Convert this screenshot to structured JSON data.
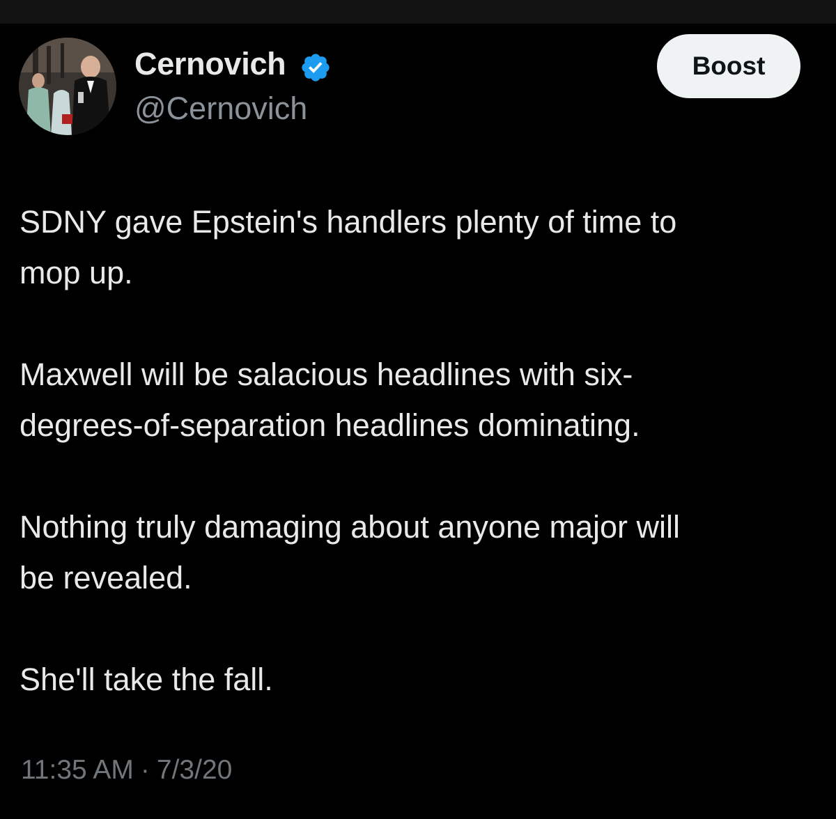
{
  "colors": {
    "background": "#000000",
    "text": "#e7e9ea",
    "secondary_text": "#71767b",
    "verified_blue": "#1d9bf0",
    "button_bg": "#eff3f4"
  },
  "author": {
    "display_name": "Cernovich",
    "handle": "@Cernovich",
    "verified_icon": "verified-badge-icon",
    "avatar": "profile-photo"
  },
  "actions": {
    "boost_label": "Boost"
  },
  "tweet": {
    "paragraphs": [
      "SDNY gave Epstein's handlers plenty of time to\nmop up.",
      "Maxwell will be salacious headlines with six-\ndegrees-of-separation headlines dominating.",
      "Nothing truly damaging about anyone major will\nbe revealed.",
      "She'll take the fall."
    ],
    "time": "11:35 AM",
    "separator": "·",
    "date": "7/3/20"
  }
}
